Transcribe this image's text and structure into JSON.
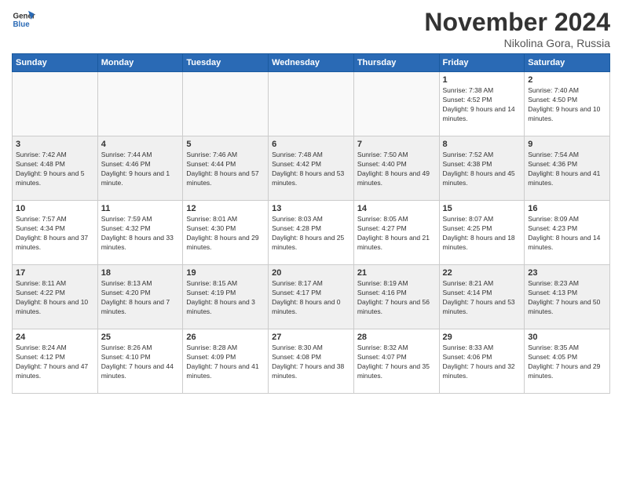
{
  "logo": {
    "line1": "General",
    "line2": "Blue"
  },
  "title": "November 2024",
  "location": "Nikolina Gora, Russia",
  "weekdays": [
    "Sunday",
    "Monday",
    "Tuesday",
    "Wednesday",
    "Thursday",
    "Friday",
    "Saturday"
  ],
  "weeks": [
    [
      {
        "day": "",
        "info": ""
      },
      {
        "day": "",
        "info": ""
      },
      {
        "day": "",
        "info": ""
      },
      {
        "day": "",
        "info": ""
      },
      {
        "day": "",
        "info": ""
      },
      {
        "day": "1",
        "info": "Sunrise: 7:38 AM\nSunset: 4:52 PM\nDaylight: 9 hours and 14 minutes."
      },
      {
        "day": "2",
        "info": "Sunrise: 7:40 AM\nSunset: 4:50 PM\nDaylight: 9 hours and 10 minutes."
      }
    ],
    [
      {
        "day": "3",
        "info": "Sunrise: 7:42 AM\nSunset: 4:48 PM\nDaylight: 9 hours and 5 minutes."
      },
      {
        "day": "4",
        "info": "Sunrise: 7:44 AM\nSunset: 4:46 PM\nDaylight: 9 hours and 1 minute."
      },
      {
        "day": "5",
        "info": "Sunrise: 7:46 AM\nSunset: 4:44 PM\nDaylight: 8 hours and 57 minutes."
      },
      {
        "day": "6",
        "info": "Sunrise: 7:48 AM\nSunset: 4:42 PM\nDaylight: 8 hours and 53 minutes."
      },
      {
        "day": "7",
        "info": "Sunrise: 7:50 AM\nSunset: 4:40 PM\nDaylight: 8 hours and 49 minutes."
      },
      {
        "day": "8",
        "info": "Sunrise: 7:52 AM\nSunset: 4:38 PM\nDaylight: 8 hours and 45 minutes."
      },
      {
        "day": "9",
        "info": "Sunrise: 7:54 AM\nSunset: 4:36 PM\nDaylight: 8 hours and 41 minutes."
      }
    ],
    [
      {
        "day": "10",
        "info": "Sunrise: 7:57 AM\nSunset: 4:34 PM\nDaylight: 8 hours and 37 minutes."
      },
      {
        "day": "11",
        "info": "Sunrise: 7:59 AM\nSunset: 4:32 PM\nDaylight: 8 hours and 33 minutes."
      },
      {
        "day": "12",
        "info": "Sunrise: 8:01 AM\nSunset: 4:30 PM\nDaylight: 8 hours and 29 minutes."
      },
      {
        "day": "13",
        "info": "Sunrise: 8:03 AM\nSunset: 4:28 PM\nDaylight: 8 hours and 25 minutes."
      },
      {
        "day": "14",
        "info": "Sunrise: 8:05 AM\nSunset: 4:27 PM\nDaylight: 8 hours and 21 minutes."
      },
      {
        "day": "15",
        "info": "Sunrise: 8:07 AM\nSunset: 4:25 PM\nDaylight: 8 hours and 18 minutes."
      },
      {
        "day": "16",
        "info": "Sunrise: 8:09 AM\nSunset: 4:23 PM\nDaylight: 8 hours and 14 minutes."
      }
    ],
    [
      {
        "day": "17",
        "info": "Sunrise: 8:11 AM\nSunset: 4:22 PM\nDaylight: 8 hours and 10 minutes."
      },
      {
        "day": "18",
        "info": "Sunrise: 8:13 AM\nSunset: 4:20 PM\nDaylight: 8 hours and 7 minutes."
      },
      {
        "day": "19",
        "info": "Sunrise: 8:15 AM\nSunset: 4:19 PM\nDaylight: 8 hours and 3 minutes."
      },
      {
        "day": "20",
        "info": "Sunrise: 8:17 AM\nSunset: 4:17 PM\nDaylight: 8 hours and 0 minutes."
      },
      {
        "day": "21",
        "info": "Sunrise: 8:19 AM\nSunset: 4:16 PM\nDaylight: 7 hours and 56 minutes."
      },
      {
        "day": "22",
        "info": "Sunrise: 8:21 AM\nSunset: 4:14 PM\nDaylight: 7 hours and 53 minutes."
      },
      {
        "day": "23",
        "info": "Sunrise: 8:23 AM\nSunset: 4:13 PM\nDaylight: 7 hours and 50 minutes."
      }
    ],
    [
      {
        "day": "24",
        "info": "Sunrise: 8:24 AM\nSunset: 4:12 PM\nDaylight: 7 hours and 47 minutes."
      },
      {
        "day": "25",
        "info": "Sunrise: 8:26 AM\nSunset: 4:10 PM\nDaylight: 7 hours and 44 minutes."
      },
      {
        "day": "26",
        "info": "Sunrise: 8:28 AM\nSunset: 4:09 PM\nDaylight: 7 hours and 41 minutes."
      },
      {
        "day": "27",
        "info": "Sunrise: 8:30 AM\nSunset: 4:08 PM\nDaylight: 7 hours and 38 minutes."
      },
      {
        "day": "28",
        "info": "Sunrise: 8:32 AM\nSunset: 4:07 PM\nDaylight: 7 hours and 35 minutes."
      },
      {
        "day": "29",
        "info": "Sunrise: 8:33 AM\nSunset: 4:06 PM\nDaylight: 7 hours and 32 minutes."
      },
      {
        "day": "30",
        "info": "Sunrise: 8:35 AM\nSunset: 4:05 PM\nDaylight: 7 hours and 29 minutes."
      }
    ]
  ]
}
